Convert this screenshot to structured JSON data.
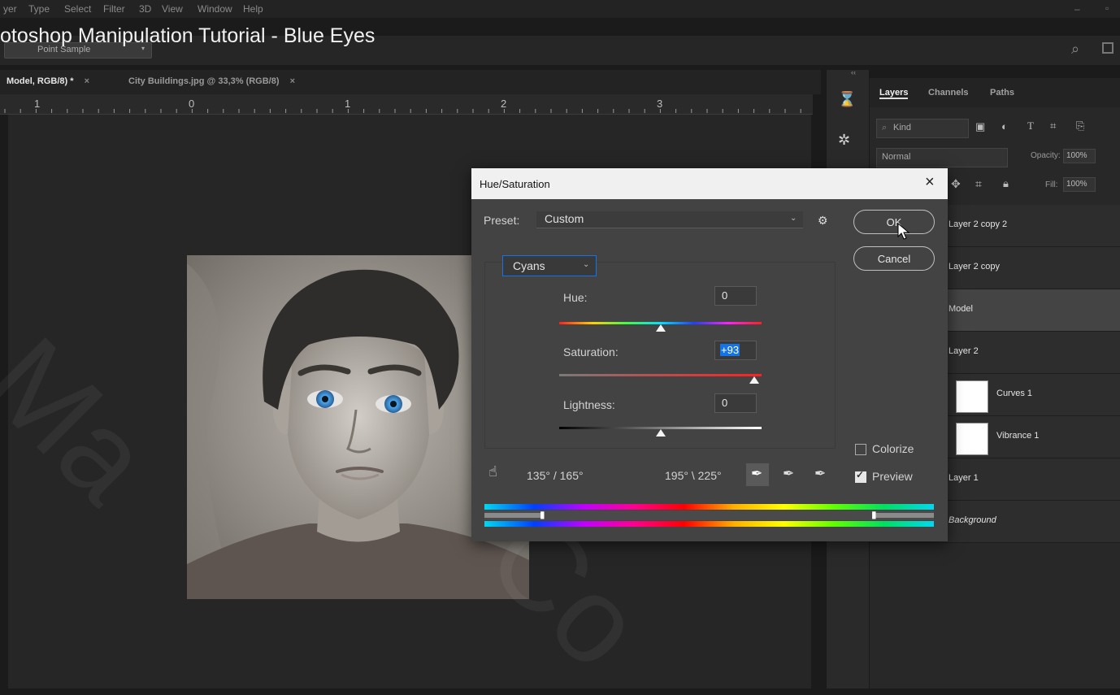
{
  "menu": [
    "yer",
    "Type",
    "Select",
    "Filter",
    "3D",
    "View",
    "Window",
    "Help"
  ],
  "video_title": "otoshop Manipulation Tutorial - Blue Eyes",
  "options": {
    "sample_field": "Point Sample"
  },
  "doc_tabs": [
    {
      "label": "Model, RGB/8) *",
      "close": "×"
    },
    {
      "label": "City Buildings.jpg @ 33,3% (RGB/8)",
      "close": "×"
    }
  ],
  "ruler": [
    "1",
    "0",
    "1",
    "2",
    "3"
  ],
  "panel": {
    "collapse": "‹‹",
    "tabs": [
      "Layers",
      "Channels",
      "Paths"
    ],
    "filter_kind": "Kind",
    "blend_mode": "Normal",
    "opacity_label": "Opacity:",
    "opacity_value": "100%",
    "fill_label": "Fill:",
    "fill_value": "100%",
    "layers": [
      {
        "name": "Layer 2 copy 2",
        "selected": false,
        "thumb": false
      },
      {
        "name": "Layer 2 copy",
        "selected": false,
        "thumb": false
      },
      {
        "name": "Model",
        "selected": true,
        "thumb": false
      },
      {
        "name": "Layer 2",
        "selected": false,
        "thumb": false
      },
      {
        "name": "Curves 1",
        "selected": false,
        "thumb": true
      },
      {
        "name": "Vibrance 1",
        "selected": false,
        "thumb": true
      },
      {
        "name": "Layer 1",
        "selected": false,
        "thumb": false
      },
      {
        "name": "Background",
        "selected": false,
        "thumb": false
      }
    ]
  },
  "dialog": {
    "title": "Hue/Saturation",
    "close": "×",
    "preset_label": "Preset:",
    "preset_value": "Custom",
    "channel": "Cyans",
    "hue_label": "Hue:",
    "hue_value": "0",
    "saturation_label": "Saturation:",
    "saturation_value": "+93",
    "lightness_label": "Lightness:",
    "lightness_value": "0",
    "range_left": "135° / 165°",
    "range_right": "195° \\ 225°",
    "ok_label": "OK",
    "cancel_label": "Cancel",
    "colorize_label": "Colorize",
    "colorize_checked": false,
    "preview_label": "Preview",
    "preview_checked": true,
    "hue_level": 0.5,
    "saturation_level": 0.965,
    "lightness_level": 0.5
  },
  "colors": {
    "accent": "#1473e6",
    "bg": "#1b1b1b",
    "dialog": "#434343"
  }
}
